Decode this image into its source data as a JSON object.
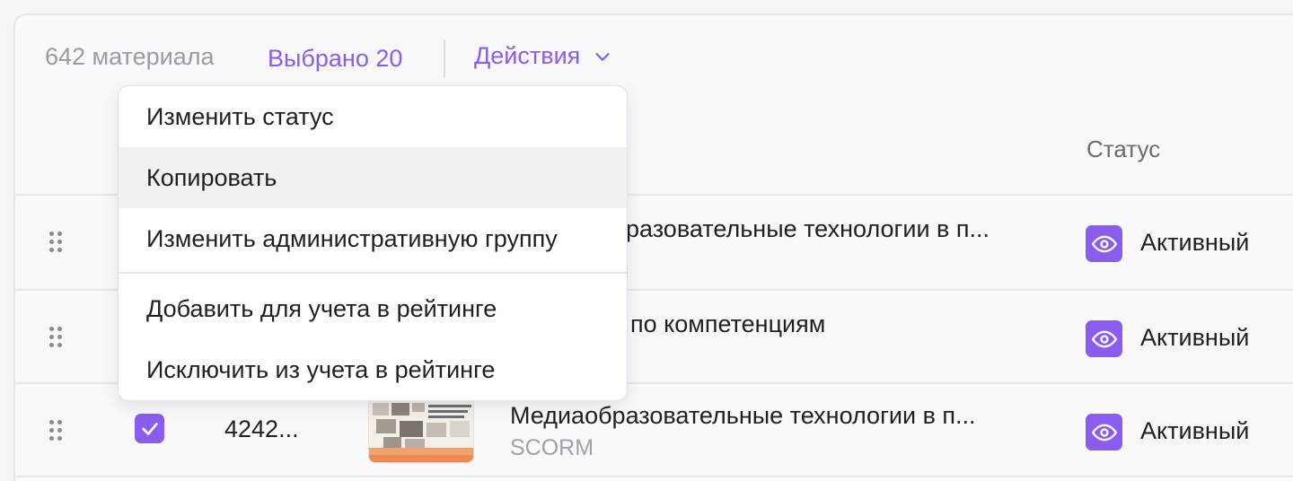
{
  "toolbar": {
    "count_label": "642 материала",
    "selected_label": "Выбрано 20",
    "actions_label": "Действия"
  },
  "table": {
    "columns": {
      "status": "Статус"
    },
    "rows": [
      {
        "id": "",
        "title": "Медиаобразовательные технологии в п...",
        "visible_title": "разовательные технологии в п...",
        "subtitle": "",
        "status": "Активный"
      },
      {
        "id": "",
        "title": "",
        "visible_title": "по компетенциям",
        "subtitle": "",
        "status": "Активный"
      },
      {
        "id": "4242...",
        "title": "Медиаобразовательные технологии в п...",
        "visible_title": "Медиаобразовательные технологии в п...",
        "subtitle": "SCORM",
        "status": "Активный"
      }
    ]
  },
  "dropdown": {
    "items": [
      {
        "label": "Изменить статус"
      },
      {
        "label": "Копировать"
      },
      {
        "label": "Изменить административную группу"
      },
      {
        "label": "Добавить для учета в рейтинге"
      },
      {
        "label": "Исключить из учета в рейтинге"
      }
    ]
  },
  "colors": {
    "accent": "#8a5cf0",
    "muted_text": "#9a9aa3",
    "hover_bg": "#f1f1f4"
  },
  "icons": {
    "actions": "chevron-down-icon",
    "drag": "drag-handle-icon",
    "status": "eye-icon",
    "checkbox": "checkmark-icon"
  }
}
